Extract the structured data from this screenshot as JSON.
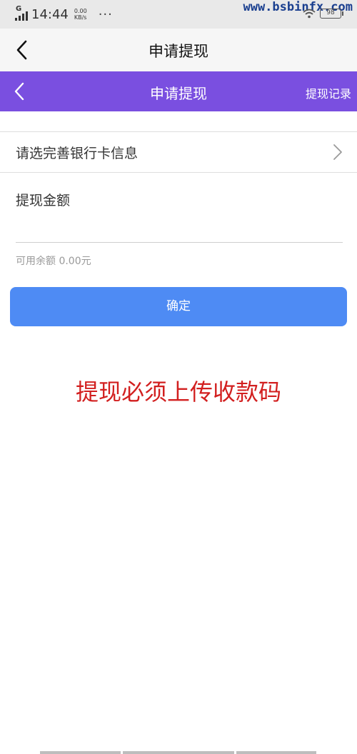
{
  "status_bar": {
    "network": "G",
    "time": "14:44",
    "speed_value": "0.00",
    "speed_unit": "KB/s",
    "more": "···",
    "battery": "98",
    "watermark": "www.bsbinfx.com"
  },
  "outer_header": {
    "title": "申请提现",
    "back_icon": "chevron-left-icon"
  },
  "purple_header": {
    "title": "申请提现",
    "record_link": "提现记录",
    "back_icon": "chevron-left-icon",
    "color": "#7a4fe0"
  },
  "form": {
    "bank_label": "请选完善银行卡信息",
    "bank_chevron_icon": "chevron-right-icon",
    "amount_label": "提现金额",
    "amount_value": "",
    "amount_placeholder": "",
    "available_text": "可用余额 0.00元",
    "confirm_label": "确定",
    "confirm_color": "#4e8bf4"
  },
  "notice": {
    "text": "提现必须上传收款码",
    "color": "#d21f1f"
  }
}
